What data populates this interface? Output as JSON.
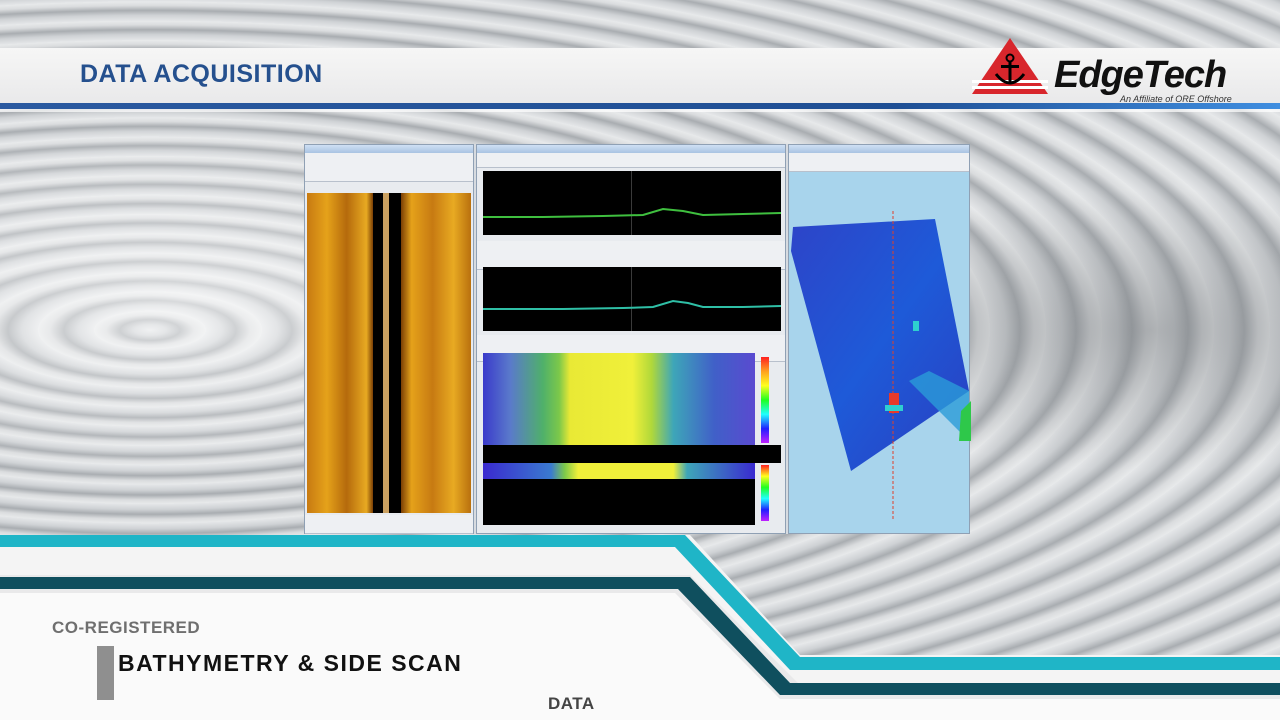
{
  "header": {
    "title": "DATA ACQUISITION"
  },
  "logo": {
    "name": "EdgeTech",
    "tagline": "An Affiliate of ORE Offshore",
    "icon": "anchor-triangle-icon"
  },
  "caption": {
    "line1": "CO-REGISTERED",
    "line2": "BATHYMETRY & SIDE SCAN",
    "line3": "DATA"
  },
  "colors": {
    "title_blue": "#25508e",
    "accent_teal": "#1fb5c7",
    "dark_teal": "#0f4f5e",
    "logo_red": "#d8262c"
  }
}
